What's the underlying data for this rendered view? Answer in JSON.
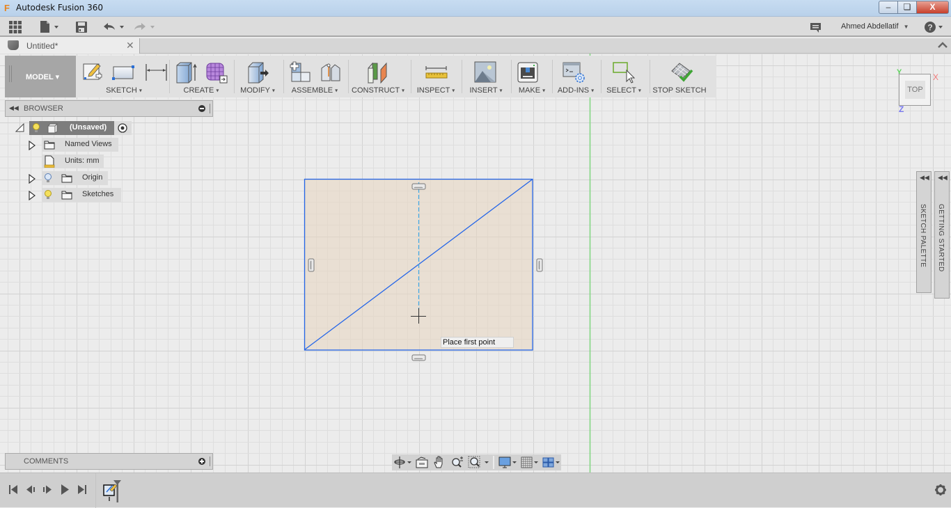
{
  "window": {
    "title": "Autodesk Fusion 360",
    "logo_glyph": "F",
    "minimize_glyph": "–",
    "maximize_glyph": "❏",
    "close_glyph": "X"
  },
  "app_toolbar": {
    "grid_menu_icon": "grid-icon",
    "file_icon": "file-icon",
    "save_icon": "save-icon",
    "undo_icon": "undo-icon",
    "redo_icon": "redo-icon",
    "notifications_icon": "chat-icon",
    "user_name": "Ahmed Abdellatif",
    "help_glyph": "?"
  },
  "tabs": [
    {
      "label": "Untitled*",
      "close_glyph": "✕",
      "active": true
    }
  ],
  "tab_collapse_glyph": "⌃",
  "ribbon": {
    "workspace": "MODEL",
    "groups": [
      {
        "label": "SKETCH",
        "icons": [
          "create-sketch-icon",
          "rectangle-icon",
          "dimension-icon"
        ]
      },
      {
        "label": "CREATE",
        "icons": [
          "extrude-icon",
          "form-icon"
        ]
      },
      {
        "label": "MODIFY",
        "icons": [
          "press-pull-icon"
        ]
      },
      {
        "label": "ASSEMBLE",
        "icons": [
          "new-component-icon",
          "joint-icon"
        ]
      },
      {
        "label": "CONSTRUCT",
        "icons": [
          "offset-plane-icon"
        ]
      },
      {
        "label": "INSPECT",
        "icons": [
          "measure-icon"
        ]
      },
      {
        "label": "INSERT",
        "icons": [
          "insert-image-icon"
        ]
      },
      {
        "label": "MAKE",
        "icons": [
          "3d-print-icon"
        ]
      },
      {
        "label": "ADD-INS",
        "icons": [
          "scripts-icon"
        ]
      },
      {
        "label": "SELECT",
        "icons": [
          "select-icon"
        ]
      },
      {
        "label": "STOP SKETCH",
        "icons": [
          "stop-sketch-icon"
        ]
      }
    ],
    "dropdown_glyph": "▾"
  },
  "browser": {
    "title": "BROWSER",
    "items": [
      {
        "label": "(Unsaved)",
        "level": 0
      },
      {
        "label": "Named Views",
        "level": 1
      },
      {
        "label": "Units: mm",
        "level": 1
      },
      {
        "label": "Origin",
        "level": 1
      },
      {
        "label": "Sketches",
        "level": 1
      }
    ]
  },
  "comments": {
    "title": "COMMENTS"
  },
  "viewcube": {
    "face": "TOP",
    "x_label": "X",
    "y_label": "Y",
    "z_label": "Z"
  },
  "side_panels": [
    {
      "label": "SKETCH PALETTE"
    },
    {
      "label": "GETTING STARTED"
    }
  ],
  "canvas": {
    "tooltip": "Place first point"
  },
  "nav_bar": {
    "tools": [
      "orbit-icon",
      "look-at-icon",
      "pan-icon",
      "zoom-icon",
      "fit-icon",
      "display-settings-icon",
      "grid-settings-icon",
      "viewports-icon"
    ]
  },
  "timeline": {
    "controls": [
      "first-icon",
      "previous-icon",
      "play-icon-small",
      "play-icon",
      "last-icon"
    ],
    "entries": [
      "sketch-feature-icon"
    ],
    "settings_icon": "gear-icon"
  }
}
